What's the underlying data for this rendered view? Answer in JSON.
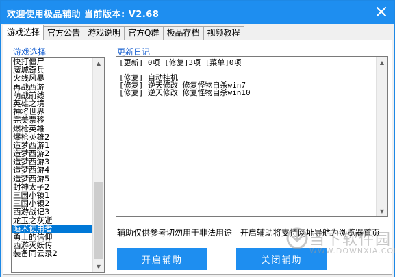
{
  "window": {
    "title": "欢迎使用极品辅助  当前版本: V2.68",
    "accent_color": "#1e8ef0",
    "close_icon": "close-icon"
  },
  "tabs": [
    {
      "label": "游戏选择",
      "active": true
    },
    {
      "label": "官方公告",
      "active": false
    },
    {
      "label": "游戏说明",
      "active": false
    },
    {
      "label": "官方Q群",
      "active": false
    },
    {
      "label": "极品存档",
      "active": false
    },
    {
      "label": "视频教程",
      "active": false
    }
  ],
  "game_select": {
    "label": "游戏选择",
    "selected_index": 20,
    "items": [
      "快打僵尸",
      "魔城奇兵",
      "火线风暴",
      "再战西游",
      "萌战前线",
      "英雄之境",
      "神将世界",
      "完美票移",
      "爆枪英雄",
      "爆枪英雄2",
      "造梦西游1",
      "造梦西游2",
      "造梦西游3",
      "造梦西游4",
      "造梦西游5",
      "封神太子2",
      "三国小镇1",
      "三国小镇2",
      "西游战记3",
      "龙玉之灰逝",
      "睡术使用者",
      "勇士的信仰",
      "西游灭妖传",
      "装备同云录2"
    ]
  },
  "changelog": {
    "label": "更新日记",
    "lines": [
      "[更新] 0项 [修复]3项 [菜单]0项",
      "",
      "[修复] 自动挂机",
      "[修复] 逆天修改 修复怪物自杀win7",
      "[修复] 逆天修改 修复怪物自杀win10"
    ]
  },
  "notice": {
    "left": "辅助仅供参考切勿用于非法用途",
    "right": "开启辅助将支持网址导航为浏览器首页"
  },
  "buttons": {
    "start": "开启辅助",
    "stop": "关闭辅助"
  },
  "watermark": {
    "brand": "当下软件园",
    "sub": "WWW.DOWNXIA.COM"
  }
}
